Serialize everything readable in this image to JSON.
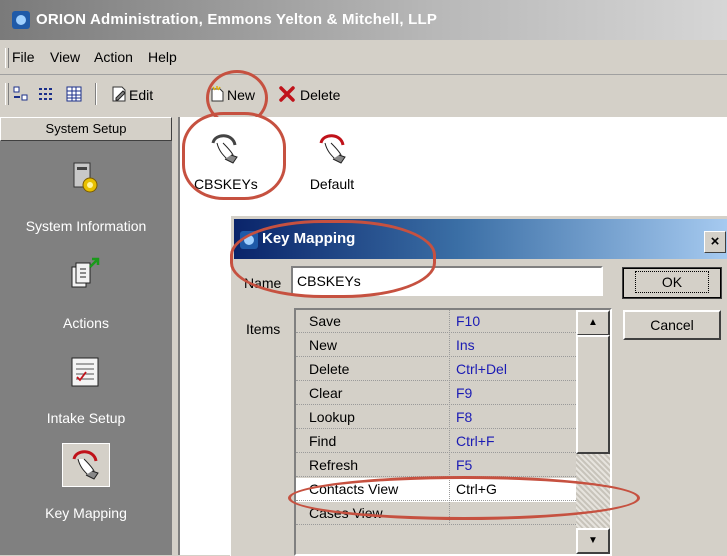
{
  "window": {
    "title": "ORION Administration, Emmons Yelton & Mitchell, LLP"
  },
  "menu": [
    "File",
    "View",
    "Action",
    "Help"
  ],
  "toolbar": {
    "edit_label": "Edit",
    "new_label": "New",
    "delete_label": "Delete"
  },
  "left_panel": {
    "header": "System Setup",
    "items": [
      {
        "label": "System Information",
        "icon": "gear-computer-icon"
      },
      {
        "label": "Actions",
        "icon": "documents-arrow-icon"
      },
      {
        "label": "Intake Setup",
        "icon": "form-checklist-icon"
      },
      {
        "label": "Key Mapping",
        "icon": "hand-key-icon"
      }
    ]
  },
  "content_items": [
    {
      "label": "CBSKEYs",
      "icon": "hand-key-icon"
    },
    {
      "label": "Default",
      "icon": "hand-key-icon"
    }
  ],
  "dialog": {
    "title": "Key Mapping",
    "close_label": "×",
    "name_label": "Name",
    "name_value": "CBSKEYs",
    "items_label": "Items",
    "ok_label": "OK",
    "cancel_label": "Cancel",
    "rows": [
      {
        "action": "Save",
        "key": "F10"
      },
      {
        "action": "New",
        "key": "Ins"
      },
      {
        "action": "Delete",
        "key": "Ctrl+Del"
      },
      {
        "action": "Clear",
        "key": "F9"
      },
      {
        "action": "Lookup",
        "key": "F8"
      },
      {
        "action": "Find",
        "key": "Ctrl+F"
      },
      {
        "action": "Refresh",
        "key": "F5"
      },
      {
        "action": "Contacts View",
        "key": "Ctrl+G"
      },
      {
        "action": "Cases View",
        "key": ""
      }
    ],
    "selected_row": 7,
    "scroll_up": "▲",
    "scroll_down": "▼"
  },
  "colors": {
    "highlight_oval": "#c65140",
    "grid_key_text": "#1b1bb4",
    "dialog_title": "#0a246a"
  }
}
